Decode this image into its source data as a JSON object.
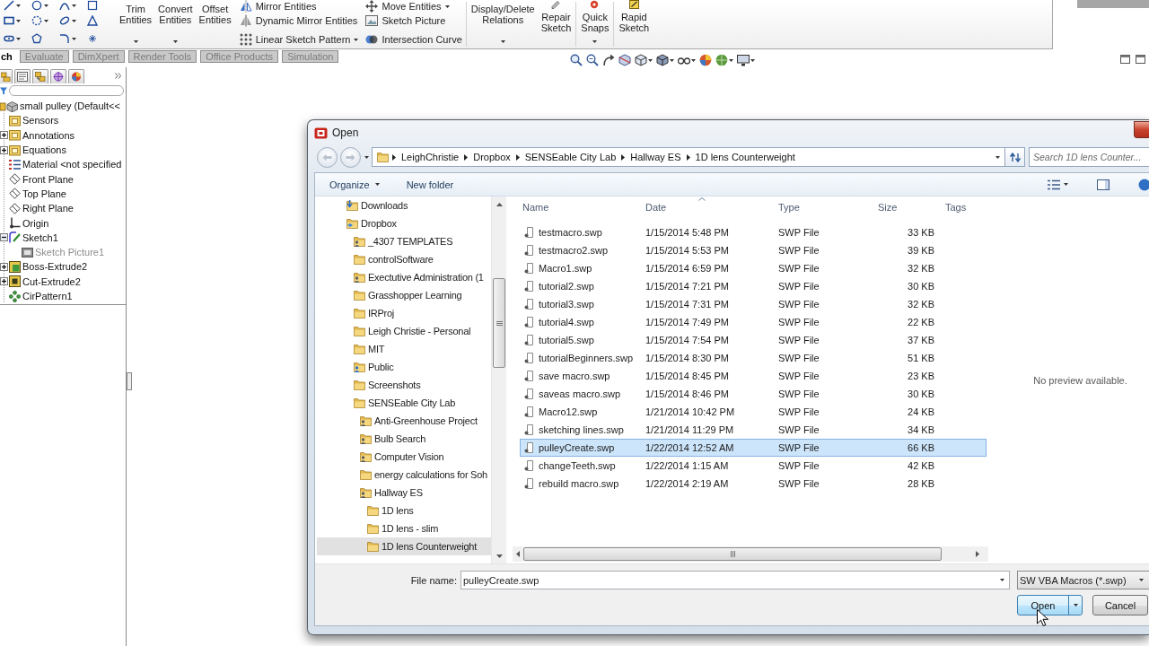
{
  "ribbon": {
    "groups": [
      {
        "kind": "large",
        "items": [
          {
            "label": "Trim Entities",
            "dropdown": true
          },
          {
            "label": "Convert Entities",
            "dropdown": true
          },
          {
            "label": "Offset Entities",
            "dropdown": false
          }
        ]
      },
      {
        "kind": "list",
        "items": [
          {
            "label": "Mirror Entities",
            "dropdown": false
          },
          {
            "label": "Dynamic Mirror Entities",
            "dropdown": false
          },
          {
            "label": "Linear Sketch Pattern",
            "dropdown": true
          }
        ]
      },
      {
        "kind": "list",
        "items": [
          {
            "label": "Move Entities",
            "dropdown": true
          },
          {
            "label": "Sketch Picture",
            "dropdown": false
          },
          {
            "label": "Intersection Curve",
            "dropdown": false
          }
        ]
      },
      {
        "kind": "large",
        "items": [
          {
            "label": "Display/Delete Relations",
            "dropdown": true
          },
          {
            "label": "Repair Sketch",
            "dropdown": false
          }
        ]
      },
      {
        "kind": "large",
        "items": [
          {
            "label": "Quick Snaps",
            "dropdown": true
          }
        ]
      },
      {
        "kind": "large",
        "items": [
          {
            "label": "Rapid Sketch",
            "dropdown": false
          }
        ]
      }
    ]
  },
  "command_tabs": [
    {
      "label": "ch",
      "selected": true
    },
    {
      "label": "Evaluate",
      "selected": false
    },
    {
      "label": "DimXpert",
      "selected": false
    },
    {
      "label": "Render Tools",
      "selected": false
    },
    {
      "label": "Office Products",
      "selected": false
    },
    {
      "label": "Simulation",
      "selected": false
    }
  ],
  "feature_tree": {
    "items": [
      {
        "label": "small pulley (Default<<",
        "kind": "part",
        "children": [
          {
            "label": "Sensors",
            "kind": "folder"
          },
          {
            "label": "Annotations",
            "kind": "folder",
            "expanded": false
          },
          {
            "label": "Equations",
            "kind": "folder",
            "expanded": false
          },
          {
            "label": "Material <not specified",
            "kind": "material"
          },
          {
            "label": "Front Plane",
            "kind": "plane"
          },
          {
            "label": "Top Plane",
            "kind": "plane"
          },
          {
            "label": "Right Plane",
            "kind": "plane"
          },
          {
            "label": "Origin",
            "kind": "origin"
          },
          {
            "label": "Sketch1",
            "kind": "sketch",
            "expanded": true,
            "children": [
              {
                "label": "Sketch Picture1",
                "kind": "picture",
                "hidden": true
              }
            ]
          },
          {
            "label": "Boss-Extrude2",
            "kind": "boss",
            "expanded": false
          },
          {
            "label": "Cut-Extrude2",
            "kind": "cut",
            "expanded": false
          },
          {
            "label": "CirPattern1",
            "kind": "pattern"
          }
        ]
      }
    ]
  },
  "dialog": {
    "title": "Open",
    "breadcrumb": [
      "LeighChristie",
      "Dropbox",
      "SENSEable City Lab",
      "Hallway ES",
      "1D lens Counterweight"
    ],
    "search": {
      "placeholder": "Search 1D lens Counter..."
    },
    "commands": [
      {
        "label": "Organize",
        "dropdown": true
      },
      {
        "label": "New folder",
        "dropdown": false
      }
    ],
    "navigation": [
      {
        "label": "Downloads",
        "kind": "downloads",
        "selected": false
      },
      {
        "label": "Dropbox",
        "kind": "dropbox",
        "selected": false,
        "children": [
          {
            "label": "_4307 TEMPLATES",
            "kind": "shared",
            "selected": false
          },
          {
            "label": "controlSoftware",
            "kind": "folder",
            "selected": false
          },
          {
            "label": "Exectutive Administration (1",
            "kind": "shared",
            "selected": false
          },
          {
            "label": "Grasshopper Learning",
            "kind": "folder",
            "selected": false
          },
          {
            "label": "IRProj",
            "kind": "folder",
            "selected": false
          },
          {
            "label": "Leigh Christie - Personal",
            "kind": "folder",
            "selected": false
          },
          {
            "label": "MIT",
            "kind": "folder",
            "selected": false
          },
          {
            "label": "Public",
            "kind": "public",
            "selected": false
          },
          {
            "label": "Screenshots",
            "kind": "folder",
            "selected": false
          },
          {
            "label": "SENSEable City Lab",
            "kind": "folder",
            "selected": false,
            "children": [
              {
                "label": "Anti-Greenhouse Project",
                "kind": "shared",
                "selected": false
              },
              {
                "label": "Bulb Search",
                "kind": "shared",
                "selected": false
              },
              {
                "label": "Computer Vision",
                "kind": "shared",
                "selected": false
              },
              {
                "label": "energy calculations for Soh",
                "kind": "folder",
                "selected": false
              },
              {
                "label": "Hallway ES",
                "kind": "shared",
                "selected": false,
                "children": [
                  {
                    "label": "1D lens",
                    "kind": "folder",
                    "selected": false
                  },
                  {
                    "label": "1D lens - slim",
                    "kind": "folder",
                    "selected": false
                  },
                  {
                    "label": "1D lens Counterweight",
                    "kind": "folder",
                    "selected": true
                  }
                ]
              }
            ]
          }
        ]
      }
    ],
    "columns": [
      {
        "label": "Name",
        "sorted": false
      },
      {
        "label": "Date",
        "sorted": true
      },
      {
        "label": "Type",
        "sorted": false
      },
      {
        "label": "Size",
        "sorted": false
      },
      {
        "label": "Tags",
        "sorted": false
      }
    ],
    "files": [
      {
        "name": "testmacro.swp",
        "date": "1/15/2014 5:48 PM",
        "type": "SWP File",
        "size": "33 KB",
        "selected": false
      },
      {
        "name": "testmacro2.swp",
        "date": "1/15/2014 5:53 PM",
        "type": "SWP File",
        "size": "39 KB",
        "selected": false
      },
      {
        "name": "Macro1.swp",
        "date": "1/15/2014 6:59 PM",
        "type": "SWP File",
        "size": "32 KB",
        "selected": false
      },
      {
        "name": "tutorial2.swp",
        "date": "1/15/2014 7:21 PM",
        "type": "SWP File",
        "size": "30 KB",
        "selected": false
      },
      {
        "name": "tutorial3.swp",
        "date": "1/15/2014 7:31 PM",
        "type": "SWP File",
        "size": "32 KB",
        "selected": false
      },
      {
        "name": "tutorial4.swp",
        "date": "1/15/2014 7:49 PM",
        "type": "SWP File",
        "size": "22 KB",
        "selected": false
      },
      {
        "name": "tutorial5.swp",
        "date": "1/15/2014 7:54 PM",
        "type": "SWP File",
        "size": "37 KB",
        "selected": false
      },
      {
        "name": "tutorialBeginners.swp",
        "date": "1/15/2014 8:30 PM",
        "type": "SWP File",
        "size": "51 KB",
        "selected": false
      },
      {
        "name": "save macro.swp",
        "date": "1/15/2014 8:45 PM",
        "type": "SWP File",
        "size": "23 KB",
        "selected": false
      },
      {
        "name": "saveas macro.swp",
        "date": "1/15/2014 8:46 PM",
        "type": "SWP File",
        "size": "30 KB",
        "selected": false
      },
      {
        "name": "Macro12.swp",
        "date": "1/21/2014 10:42 PM",
        "type": "SWP File",
        "size": "24 KB",
        "selected": false
      },
      {
        "name": "sketching lines.swp",
        "date": "1/21/2014 11:29 PM",
        "type": "SWP File",
        "size": "34 KB",
        "selected": false
      },
      {
        "name": "pulleyCreate.swp",
        "date": "1/22/2014 12:52 AM",
        "type": "SWP File",
        "size": "66 KB",
        "selected": true
      },
      {
        "name": "changeTeeth.swp",
        "date": "1/22/2014 1:15 AM",
        "type": "SWP File",
        "size": "42 KB",
        "selected": false
      },
      {
        "name": "rebuild macro.swp",
        "date": "1/22/2014 2:19 AM",
        "type": "SWP File",
        "size": "28 KB",
        "selected": false
      }
    ],
    "preview": "No preview available.",
    "file_name": {
      "label": "File name:",
      "value": "pulleyCreate.swp"
    },
    "file_type": "SW VBA Macros (*.swp)",
    "buttons": [
      {
        "label": "Open",
        "kind": "split"
      },
      {
        "label": "Cancel",
        "kind": "plain"
      }
    ]
  }
}
